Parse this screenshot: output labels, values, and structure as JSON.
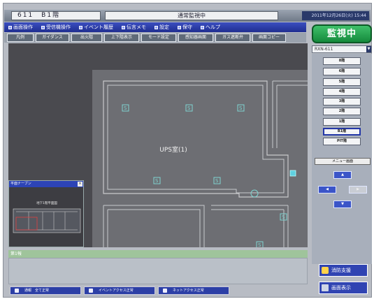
{
  "header": {
    "room": "611　B1階",
    "mode": "通常監視中",
    "clock": "2011年12月26日(火) 15:44"
  },
  "menu": [
    {
      "label": "画面操作"
    },
    {
      "label": "受信機操作"
    },
    {
      "label": "イベント履歴"
    },
    {
      "label": "伝言メモ"
    },
    {
      "label": "設定"
    },
    {
      "label": "保守"
    },
    {
      "label": "ヘルプ"
    }
  ],
  "toolbar": [
    {
      "label": "凡例"
    },
    {
      "label": "ガイダンス"
    },
    {
      "label": "出火階"
    },
    {
      "label": "上下階表示"
    },
    {
      "label": "モード設定"
    },
    {
      "label": "感知器画面"
    },
    {
      "label": "ガス遮断弁"
    },
    {
      "label": "画面コピー"
    }
  ],
  "badge": "監視中",
  "unit_select": "RXN-611",
  "floors": [
    "8階",
    "6階",
    "5階",
    "4階",
    "3階",
    "2階",
    "1階",
    "B1階",
    "PIT階"
  ],
  "selected_floor": "B1階",
  "screen_menu": "メニュー画面",
  "floorplan": {
    "room_label": "UPS室(1)",
    "sensor_glyph": "S"
  },
  "minimap": {
    "title": "平面ナーブン",
    "label": "地下1階平面図"
  },
  "info": {
    "title": "第1報"
  },
  "right_buttons": {
    "aid": "消防支援",
    "screen": "画面表示"
  },
  "status": [
    {
      "label": "通報　全て正常"
    },
    {
      "label": "イベントアクセス正常"
    },
    {
      "label": "ネットアクセス正常"
    }
  ],
  "colors": {
    "menu_bar": "#1f2e90",
    "monitor_badge": "#158a3c",
    "info_bar": "#9fc49b",
    "floorplan_bg": "#4a4a4f",
    "sensor": "#7fd4d0"
  }
}
